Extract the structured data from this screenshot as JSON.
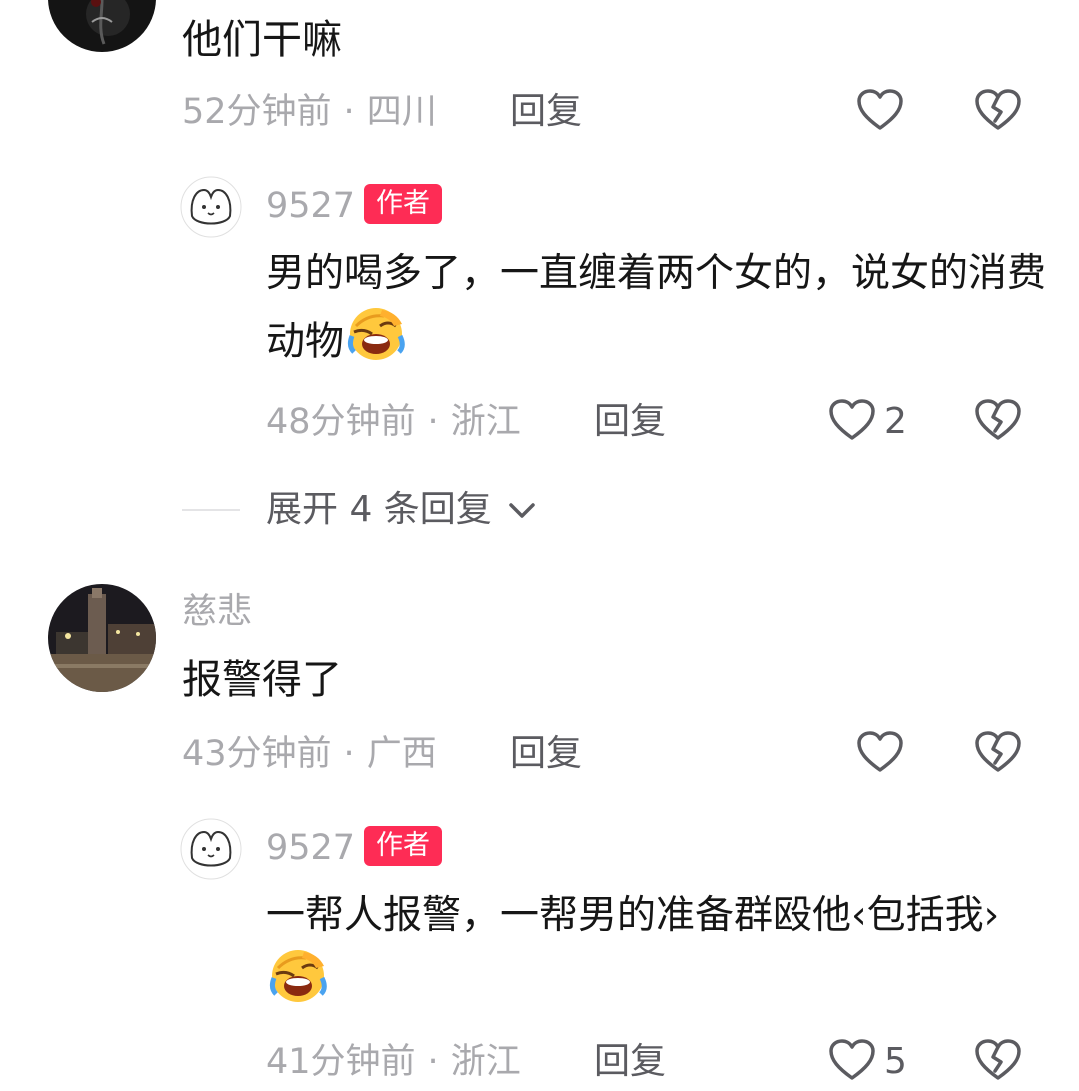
{
  "comments": [
    {
      "text": "他们干嘛",
      "time": "52分钟前",
      "location": "四川",
      "reply_label": "回复",
      "replies": [
        {
          "username": "9527",
          "badge": "作者",
          "text": "男的喝多了，一直缠着两个女的，说女的消费动物",
          "emoji": "crying-laughing-emoji",
          "time": "48分钟前",
          "location": "浙江",
          "reply_label": "回复",
          "like_count": "2"
        }
      ],
      "expand_label": "展开 4 条回复"
    },
    {
      "username": "慈悲",
      "text": "报警得了",
      "time": "43分钟前",
      "location": "广西",
      "reply_label": "回复",
      "replies": [
        {
          "username": "9527",
          "badge": "作者",
          "text": "一帮人报警，一帮男的准备群殴他‹包括我›",
          "emoji": "crying-laughing-emoji",
          "time": "41分钟前",
          "location": "浙江",
          "reply_label": "回复",
          "like_count": "5"
        }
      ]
    }
  ],
  "icons": {
    "like": "heart-outline-icon",
    "dislike": "broken-heart-icon",
    "expand": "chevron-down-icon"
  },
  "colors": {
    "author_badge": "#fe2c55",
    "meta_text": "#a9a9ad",
    "action_text": "#5b5b60"
  }
}
